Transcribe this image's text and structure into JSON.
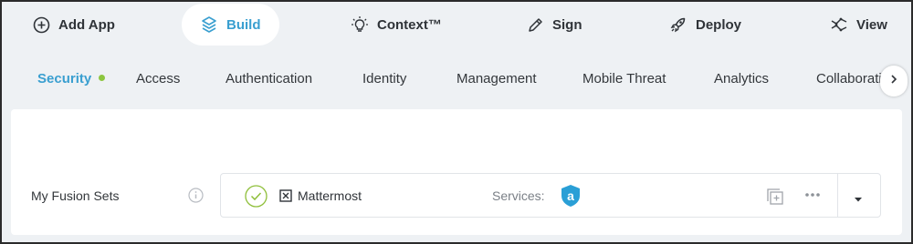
{
  "topbar": {
    "items": [
      {
        "label": "Add App",
        "icon": "plus-circle-icon"
      },
      {
        "label": "Build",
        "icon": "build-cube-icon",
        "active": true
      },
      {
        "label": "Context™",
        "icon": "lightbulb-icon"
      },
      {
        "label": "Sign",
        "icon": "pen-icon"
      },
      {
        "label": "Deploy",
        "icon": "rocket-icon"
      },
      {
        "label": "View",
        "icon": "view-network-icon"
      }
    ]
  },
  "tabs": {
    "items": [
      {
        "label": "Security",
        "active": true,
        "status_dot": true
      },
      {
        "label": "Access"
      },
      {
        "label": "Authentication"
      },
      {
        "label": "Identity"
      },
      {
        "label": "Management"
      },
      {
        "label": "Mobile Threat"
      },
      {
        "label": "Analytics"
      },
      {
        "label": "Collaborati"
      }
    ],
    "scroll_icon": "chevron-right-icon"
  },
  "fusion_sets": {
    "label": "My Fusion Sets",
    "app_name": "Mattermost",
    "services_label": "Services:",
    "service_icon_letter": "a"
  },
  "colors": {
    "accent": "#3a9fd0",
    "status_green": "#8cc63f",
    "check_green": "#8fbf3a",
    "shield_blue": "#2a9fd6"
  }
}
